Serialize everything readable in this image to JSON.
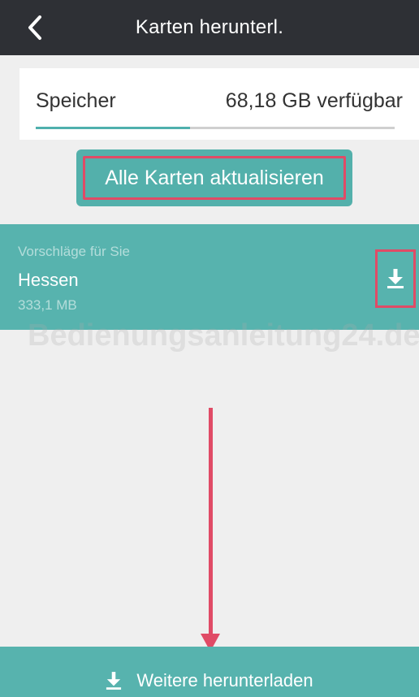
{
  "navbar": {
    "back_icon": "chevron-left-icon",
    "title": "Karten herunterl."
  },
  "storage": {
    "label": "Speicher",
    "value": "68,18 GB verfügbar",
    "used_fraction": 0.43
  },
  "update_button": {
    "label": "Alle Karten aktualisieren"
  },
  "suggestions": {
    "header": "Vorschläge für Sie",
    "items": [
      {
        "name": "Hessen",
        "size": "333,1 MB",
        "icon": "download-icon"
      }
    ]
  },
  "watermark": "Bedienungsanleitung24.de",
  "bottom_bar": {
    "icon": "download-icon",
    "label": "Weitere herunterladen"
  },
  "colors": {
    "navbar": "#2e3035",
    "teal": "#57b3ae",
    "highlight": "#e04b66",
    "background": "#efefef"
  }
}
